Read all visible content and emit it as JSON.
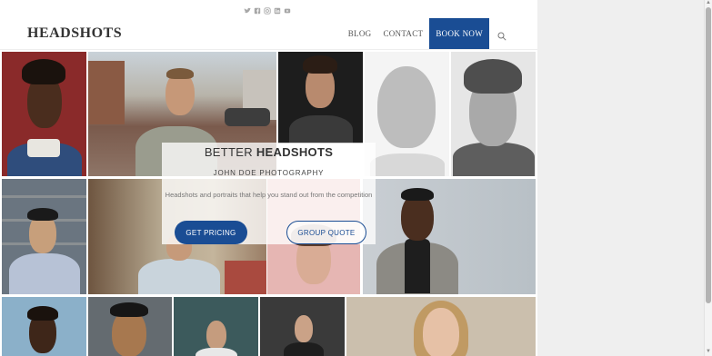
{
  "header": {
    "logo": "HEADSHOTS",
    "social_icons": [
      "twitter-icon",
      "facebook-icon",
      "instagram-icon",
      "linkedin-icon",
      "youtube-icon"
    ],
    "nav": {
      "blog": "BLOG",
      "contact": "CONTACT",
      "book_now": "BOOK NOW"
    }
  },
  "hero": {
    "title_light": "BETTER",
    "title_bold": "HEADSHOTS",
    "subtitle": "JOHN DOE PHOTOGRAPHY",
    "description": "Headshots and portraits that help you stand out from the competition",
    "primary_button": "GET PRICING",
    "secondary_button": "GROUP QUOTE"
  },
  "colors": {
    "brand_blue": "#1a4d94",
    "background": "#ffffff",
    "outer_background": "#ededed"
  }
}
